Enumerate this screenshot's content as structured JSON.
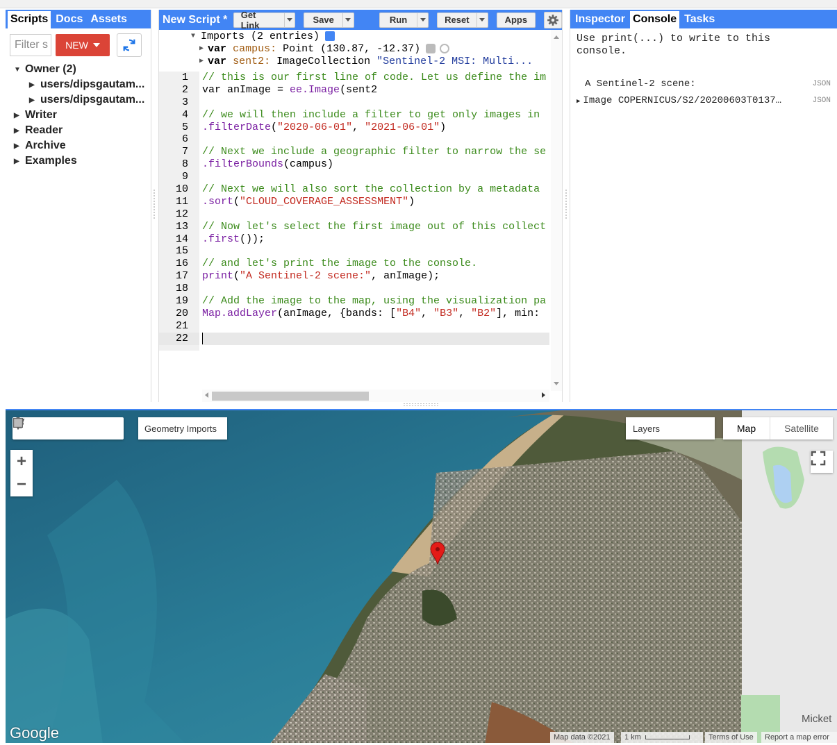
{
  "left_panel": {
    "tabs": [
      "Scripts",
      "Docs",
      "Assets"
    ],
    "filter_placeholder": "Filter s",
    "new_button": "NEW",
    "tree": {
      "owner": "Owner (2)",
      "owner_items": [
        "users/dipsgautam...",
        "users/dipsgautam..."
      ],
      "folders": [
        "Writer",
        "Reader",
        "Archive",
        "Examples"
      ]
    }
  },
  "editor": {
    "script_title": "New Script *",
    "toolbar": {
      "get_link": "Get Link",
      "save": "Save",
      "run": "Run",
      "reset": "Reset",
      "apps": "Apps"
    },
    "imports": {
      "header": "Imports (2 entries)",
      "var_kw": "var",
      "campus_name": "campus:",
      "campus_value": "Point (130.87, -12.37)",
      "sent2_name": "sent2:",
      "sent2_type": "ImageCollection",
      "sent2_value": "\"Sentinel-2 MSI: Multi..."
    },
    "line_numbers": [
      "1",
      "2",
      "3",
      "4",
      "5",
      "6",
      "7",
      "8",
      "9",
      "10",
      "11",
      "12",
      "13",
      "14",
      "15",
      "16",
      "17",
      "18",
      "19",
      "20",
      "21",
      "22"
    ],
    "code": {
      "l1": "// this is our first line of code. Let us define the im",
      "l2_kw": "var",
      "l2_name": " anImage = ",
      "l2_fn": "ee.Image",
      "l2_rest": "(sent2",
      "l4": "// we will then include a filter to get only images in",
      "l5_fn": ".filterDate",
      "l5_a": "(",
      "l5_s1": "\"2020-06-01\"",
      "l5_b": ", ",
      "l5_s2": "\"2021-06-01\"",
      "l5_c": ")",
      "l7": "// Next we include a geographic filter to narrow the se",
      "l8_fn": ".filterBounds",
      "l8_rest": "(campus)",
      "l10": "// Next we will also sort the collection by a metadata",
      "l11_fn": ".sort",
      "l11_a": "(",
      "l11_s": "\"CLOUD_COVERAGE_ASSESSMENT\"",
      "l11_b": ")",
      "l13": "// Now let's select the first image out of this collect",
      "l14_fn": ".first",
      "l14_rest": "());",
      "l16": "// and let's print the image to the console.",
      "l17_fn": "print",
      "l17_a": "(",
      "l17_s": "\"A Sentinel-2 scene:\"",
      "l17_b": ", anImage);",
      "l19": "// Add the image to the map, using the visualization pa",
      "l20_fn": "Map.addLayer",
      "l20_a": "(anImage, {bands: [",
      "l20_s1": "\"B4\"",
      "l20_b": ", ",
      "l20_s2": "\"B3\"",
      "l20_c": ", ",
      "l20_s3": "\"B2\"",
      "l20_d": "], min:"
    }
  },
  "right_panel": {
    "tabs": [
      "Inspector",
      "Console",
      "Tasks"
    ],
    "hint_line1": "Use print(...) to write to this",
    "hint_line2": "console.",
    "entries": [
      {
        "text": "A Sentinel-2 scene:",
        "tag": "JSON"
      },
      {
        "text": "Image COPERNICUS/S2/20200603T0137…",
        "tag": "JSON"
      }
    ]
  },
  "map": {
    "geometry_imports": "Geometry Imports",
    "layers": "Layers",
    "map_type_map": "Map",
    "map_type_satellite": "Satellite",
    "zoom_in": "+",
    "zoom_out": "−",
    "google_logo": "Google",
    "place_label": "Micket",
    "map_data": "Map data ©2021",
    "scale": "1 km",
    "terms": "Terms of Use",
    "report": "Report a map error"
  },
  "colors": {
    "accent": "#4285f4",
    "new_button": "#db4437",
    "comment": "#3a8a1a",
    "string": "#c2291f"
  }
}
